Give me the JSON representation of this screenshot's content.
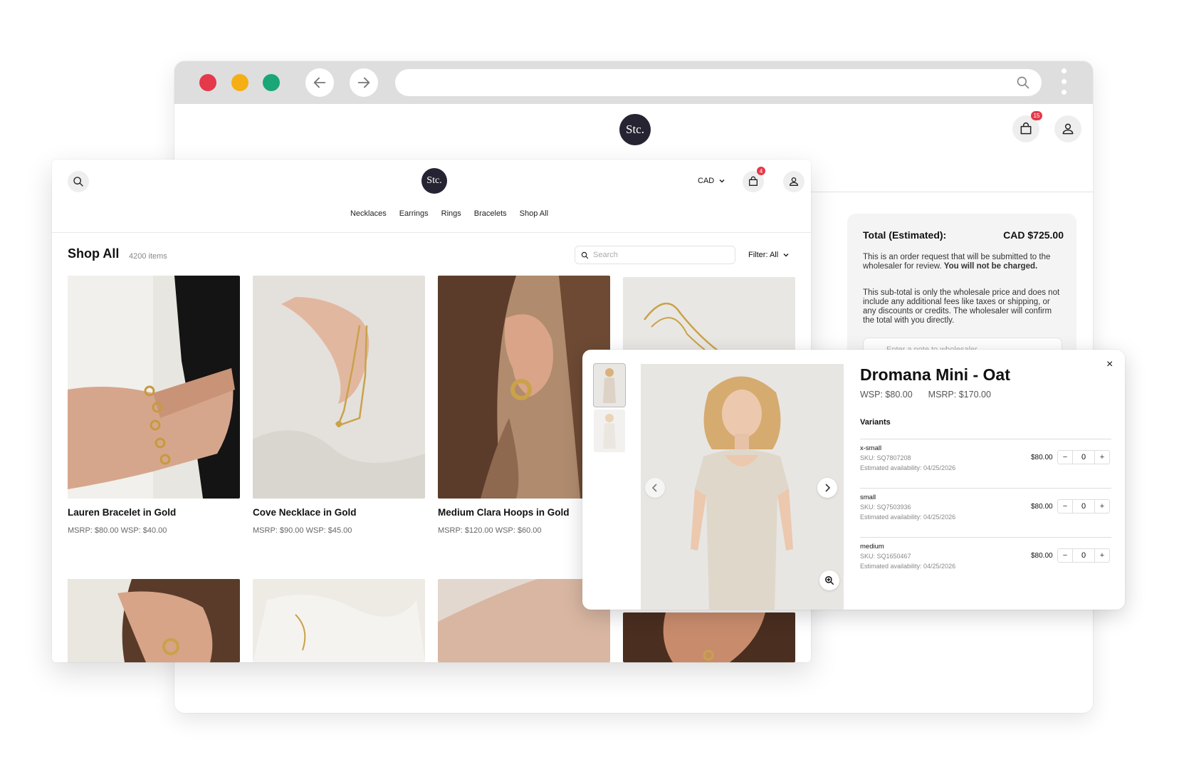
{
  "back_window": {
    "logo_text": "Stc.",
    "cart_badge": "15",
    "summary": {
      "total_label": "Total (Estimated):",
      "total_value": "CAD $725.00",
      "para1_text": "This is an order request that will be submitted to the wholesaler for review.",
      "para1_bold": "You will not be charged.",
      "para2": "This sub-total is only the wholesale price and does not include any additional fees like taxes or shipping, or any discounts or credits. The wholesaler will confirm the total with you directly.",
      "note_placeholder": "Enter a note to wholesaler"
    }
  },
  "shop": {
    "logo_text": "Stc.",
    "currency": "CAD",
    "cart_badge": "4",
    "nav": [
      "Necklaces",
      "Earrings",
      "Rings",
      "Bracelets",
      "Shop All"
    ],
    "title": "Shop All",
    "count": "4200 items",
    "search_placeholder": "Search",
    "filter_label": "Filter: All",
    "products": [
      {
        "name": "Lauren Bracelet in Gold",
        "price": "MSRP: $80.00   WSP: $40.00"
      },
      {
        "name": "Cove Necklace in Gold",
        "price": "MSRP: $90.00   WSP: $45.00"
      },
      {
        "name": "Medium Clara Hoops in Gold",
        "price": "MSRP: $120.00   WSP: $60.00"
      }
    ]
  },
  "quickview": {
    "title": "Dromana Mini - Oat",
    "wsp": "WSP: $80.00",
    "msrp": "MSRP: $170.00",
    "variants_label": "Variants",
    "variants": [
      {
        "name": "x-small",
        "sku": "SKU: SQ7807208",
        "availability": "Estimated availability: 04/25/2026",
        "price": "$80.00",
        "qty": "0"
      },
      {
        "name": "small",
        "sku": "SKU: SQ7503936",
        "availability": "Estimated availability: 04/25/2026",
        "price": "$80.00",
        "qty": "0"
      },
      {
        "name": "medium",
        "sku": "SKU: SQ1650467",
        "availability": "Estimated availability: 04/25/2026",
        "price": "$80.00",
        "qty": "0"
      }
    ],
    "close_glyph": "×",
    "minus_glyph": "−",
    "plus_glyph": "+"
  },
  "colors": {
    "dot_red": "#e5384a",
    "dot_yellow": "#f6ae15",
    "dot_green": "#1aa676",
    "brand_dark": "#262432",
    "badge_red": "#e5384a"
  }
}
